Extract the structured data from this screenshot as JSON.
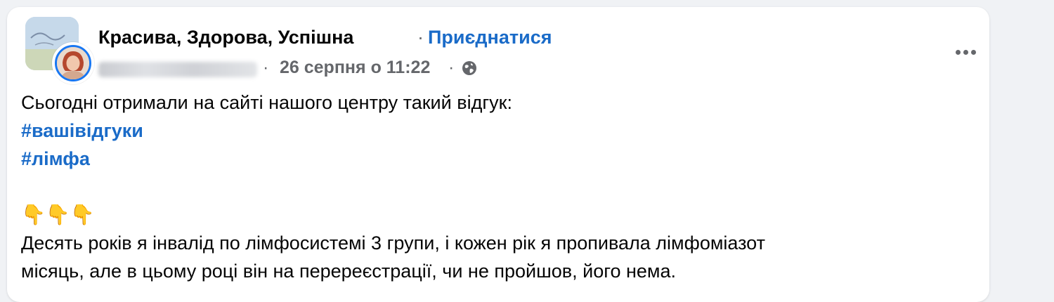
{
  "post": {
    "group_name": "Красива, Здорова, Успішна",
    "separator": "·",
    "join_label": "Приєднатися",
    "timestamp": "26 серпня о 11:22",
    "meta_separator": "·",
    "privacy_icon": "globe-icon",
    "more_icon": "more-options-icon",
    "intro_line": "Сьогодні отримали на сайті нашого центру такий відгук:",
    "hashtags": [
      "#вашівідгуки",
      "#лімфа"
    ],
    "emoji": "👇👇👇",
    "review_lines": [
      "Десять років я інвалід по лімфосистемі 3 групи, і кожен рік я пропивала лімфоміазот",
      "місяць, але в цьому році він на перереєстрації, чи не пройшов, його нема."
    ]
  },
  "colors": {
    "link": "#1a6bc8",
    "secondary_text": "#65676b",
    "background": "#f0f2f5",
    "card": "#ffffff",
    "avatar_ring": "#1877f2"
  }
}
